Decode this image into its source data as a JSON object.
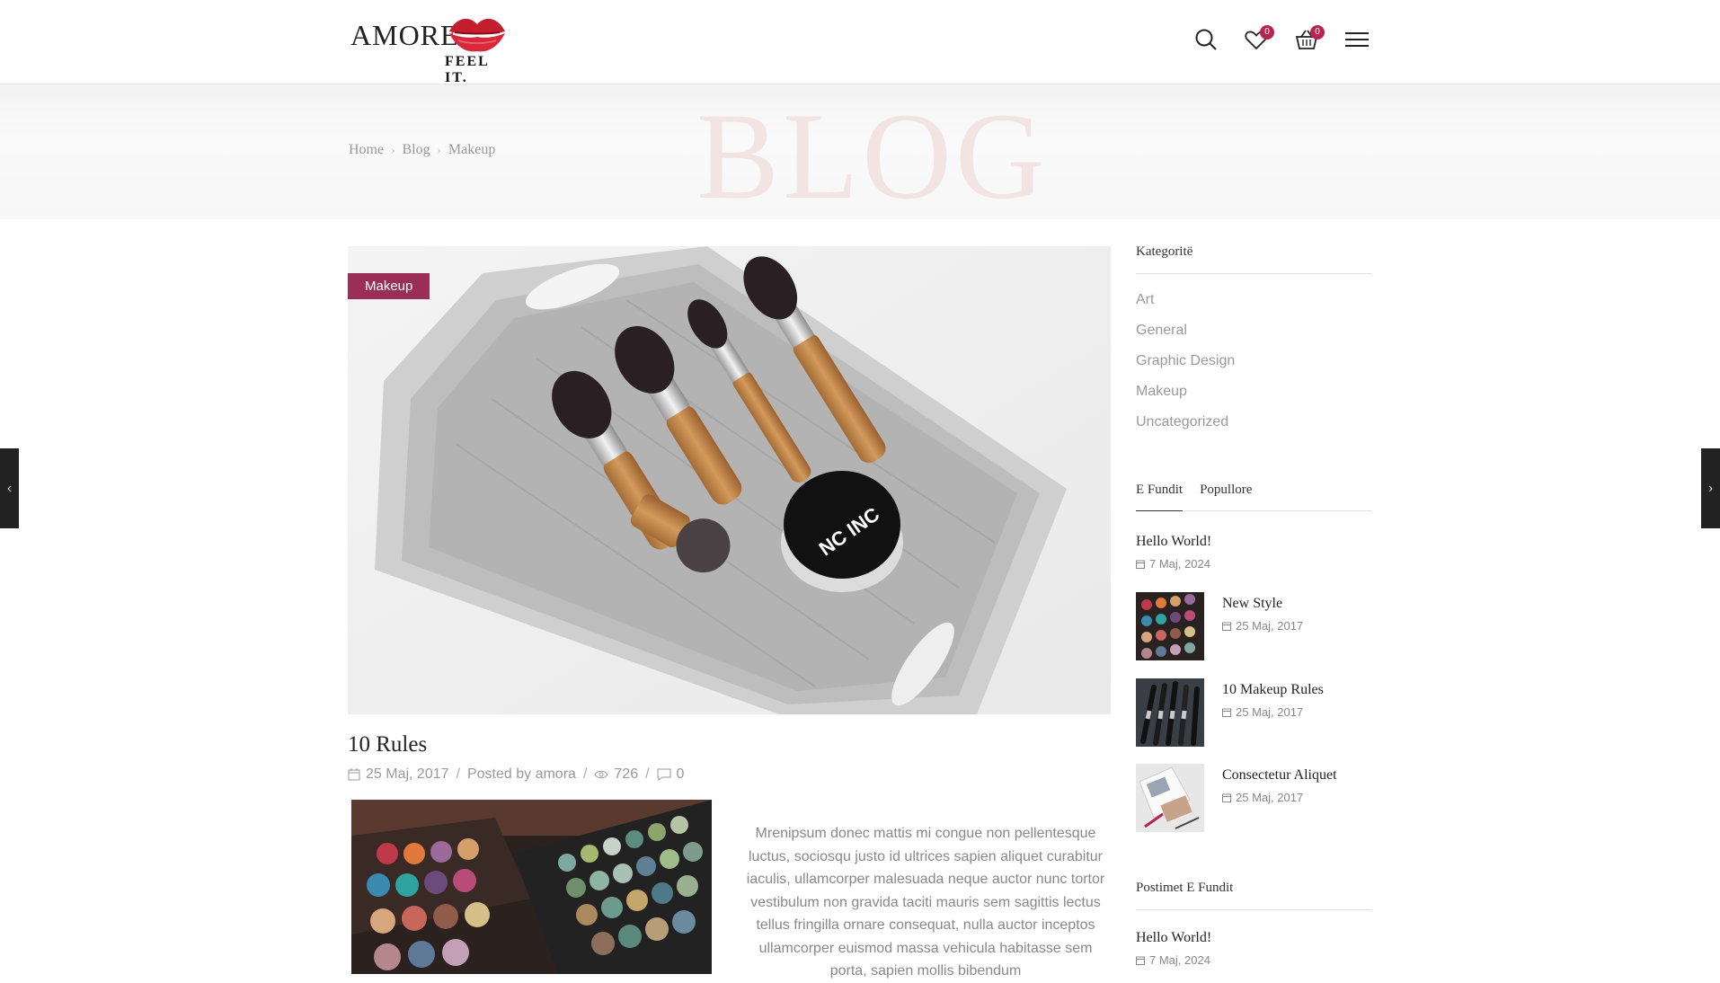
{
  "header": {
    "brand": "AMORE",
    "tagline": "FEEL IT.",
    "wishlist_count": "0",
    "cart_count": "0",
    "accent_color": "#b8234f",
    "icons": [
      "search-icon",
      "heart-icon",
      "basket-icon",
      "menu-icon"
    ]
  },
  "banner": {
    "title": "BLOG",
    "breadcrumb": [
      "Home",
      "Blog",
      "Makeup"
    ]
  },
  "post": {
    "category": "Makeup",
    "category_color": "#9a2e56",
    "title": "10 Rules",
    "date": "25 Maj, 2017",
    "posted_by": "Posted by",
    "author": "amora",
    "views": "726",
    "comments": "0",
    "excerpt": "Mrenipsum donec mattis mi congue non pellentesque luctus, sociosqu justo id ultrices sapien aliquet curabitur iaculis, ullamcorper malesuada neque auctor nunc tortor vestibulum non gravida taciti mauris sem sagittis lectus tellus fringilla ornare consequat, nulla auctor inceptos ullamcorper euismod massa vehicula habitasse sem porta, sapien mollis bibendum"
  },
  "sidebar": {
    "categories_title": "Kategoritë",
    "categories": [
      "Art",
      "General",
      "Graphic Design",
      "Makeup",
      "Uncategorized"
    ],
    "tabs": [
      "E Fundit",
      "Popullore"
    ],
    "tab_posts": [
      {
        "title": "Hello World!",
        "date": "7 Maj, 2024"
      },
      {
        "title": "New Style",
        "date": "25 Maj, 2017"
      },
      {
        "title": "10 Makeup Rules",
        "date": "25 Maj, 2017"
      },
      {
        "title": "Consectetur Aliquet",
        "date": "25 Maj, 2017"
      }
    ],
    "recent_title": "Postimet E Fundit",
    "recent_posts": [
      {
        "title": "Hello World!",
        "date": "7 Maj, 2024"
      }
    ]
  },
  "nav": {
    "prev_icon": "chevron-left-icon",
    "next_icon": "chevron-right-icon"
  }
}
